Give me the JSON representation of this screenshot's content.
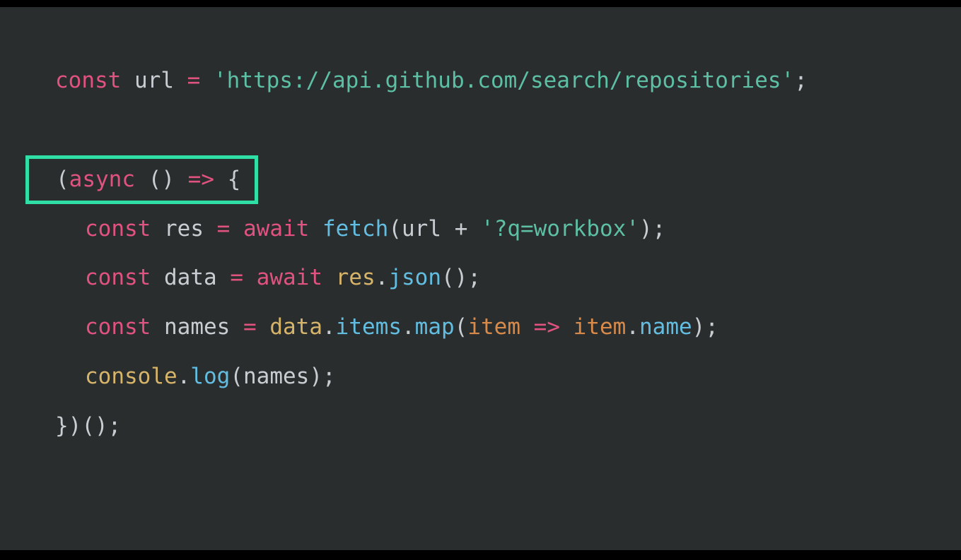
{
  "code": {
    "l1": {
      "kw": "const",
      "var": "url",
      "eq": "=",
      "str": "'https://api.github.com/search/repositories'",
      "semi": ";"
    },
    "l2": {
      "open": "(",
      "async": "async",
      "parens": "()",
      "arrow": "=>",
      "brace": "{"
    },
    "l3": {
      "kw": "const",
      "var": "res",
      "eq": "=",
      "await": "await",
      "fn": "fetch",
      "open": "(",
      "urlvar": "url",
      "plus": "+",
      "str": "'?q=workbox'",
      "close": ")",
      "semi": ";"
    },
    "l4": {
      "kw": "const",
      "var": "data",
      "eq": "=",
      "await": "await",
      "obj": "res",
      "dot": ".",
      "method": "json",
      "parens": "()",
      "semi": ";"
    },
    "l5": {
      "kw": "const",
      "var": "names",
      "eq": "=",
      "obj": "data",
      "dot1": ".",
      "prop": "items",
      "dot2": ".",
      "method": "map",
      "open": "(",
      "arg": "item",
      "arrow": "=>",
      "arg2": "item",
      "dot3": ".",
      "prop2": "name",
      "close": ")",
      "semi": ";"
    },
    "l6": {
      "obj": "console",
      "dot": ".",
      "method": "log",
      "open": "(",
      "arg": "names",
      "close": ")",
      "semi": ";"
    },
    "l7": {
      "close": "})();"
    }
  }
}
